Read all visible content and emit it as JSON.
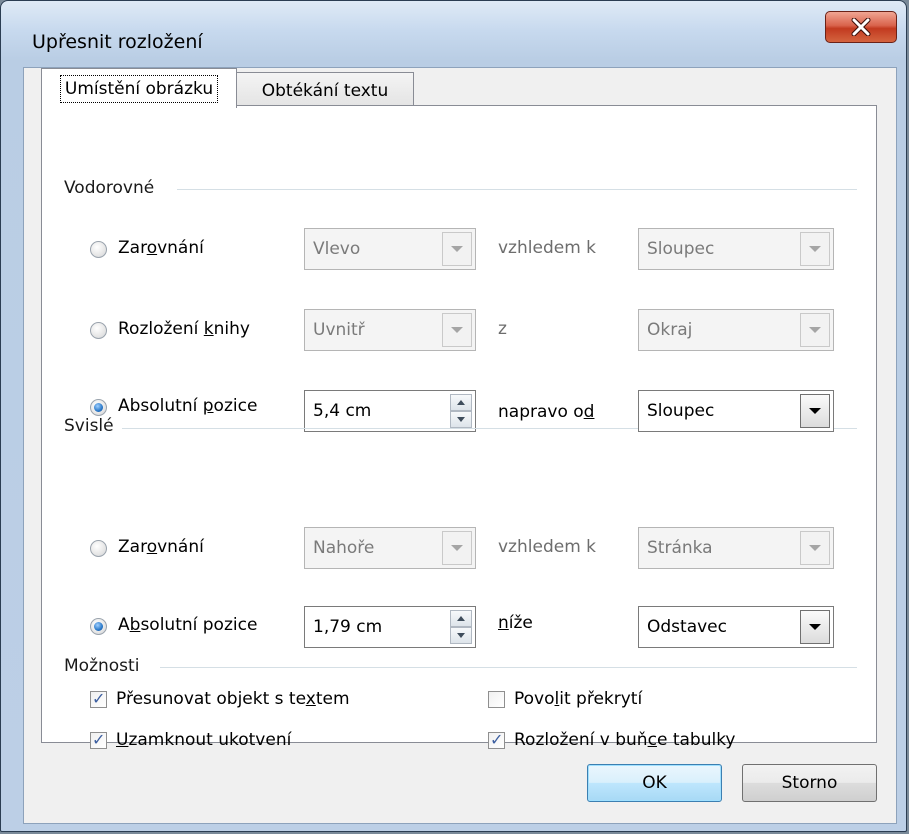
{
  "window": {
    "title": "Upřesnit rozložení",
    "close_symbol": "X"
  },
  "tabs": [
    {
      "label": "Umístění obrázku",
      "active": true
    },
    {
      "label": "Obtékání textu",
      "active": false
    }
  ],
  "horizontal": {
    "group_label": "Vodorovné",
    "rows": [
      {
        "radio_label_pre": "Zar",
        "radio_label_ul": "o",
        "radio_label_post": "vnání",
        "checked": false,
        "field": "Vlevo",
        "relation": "vzhledem k",
        "relation_ul": "",
        "relation_post": "",
        "target": "Sloupec",
        "enabled": false
      },
      {
        "radio_label_pre": "Rozložení ",
        "radio_label_ul": "k",
        "radio_label_post": "nihy",
        "checked": false,
        "field": "Uvnitř",
        "relation": "z",
        "relation_ul": "",
        "relation_post": "",
        "target": "Okraj",
        "enabled": false
      },
      {
        "radio_label_pre": "Absolutní ",
        "radio_label_ul": "p",
        "radio_label_post": "ozice",
        "checked": true,
        "field": "5,4 cm",
        "relation": "napravo o",
        "relation_ul": "d",
        "relation_post": "",
        "target": "Sloupec",
        "enabled": true
      }
    ]
  },
  "vertical": {
    "group_label": "Svislé",
    "rows": [
      {
        "radio_label_pre": "Zar",
        "radio_label_ul": "o",
        "radio_label_post": "vnání",
        "checked": false,
        "field": "Nahoře",
        "relation": "vzhledem k",
        "relation_ul": "",
        "relation_post": "",
        "target": "Stránka",
        "enabled": false
      },
      {
        "radio_label_pre": "A",
        "radio_label_ul": "b",
        "radio_label_post": "solutní pozice",
        "checked": true,
        "field": "1,79 cm",
        "relation": "",
        "relation_ul": "n",
        "relation_post": "íže",
        "target": "Odstavec",
        "enabled": true
      }
    ]
  },
  "options": {
    "group_label": "Možnosti",
    "items": [
      {
        "pre": "Přesunovat objekt s te",
        "ul": "x",
        "post": "tem",
        "checked": true
      },
      {
        "pre": "",
        "ul": "U",
        "post": "zamknout ukotvení",
        "checked": true
      },
      {
        "pre": "Povo",
        "ul": "l",
        "post": "it překrytí",
        "checked": false
      },
      {
        "pre": "Rozložení v buň",
        "ul": "c",
        "post": "e tabulky",
        "checked": true
      }
    ]
  },
  "buttons": {
    "ok": "OK",
    "cancel": "Storno"
  },
  "colors": {
    "title_bar": "#c7d9ee",
    "close_button": "#c23a20",
    "panel": "#ffffff",
    "check": "#3d5fa0"
  }
}
